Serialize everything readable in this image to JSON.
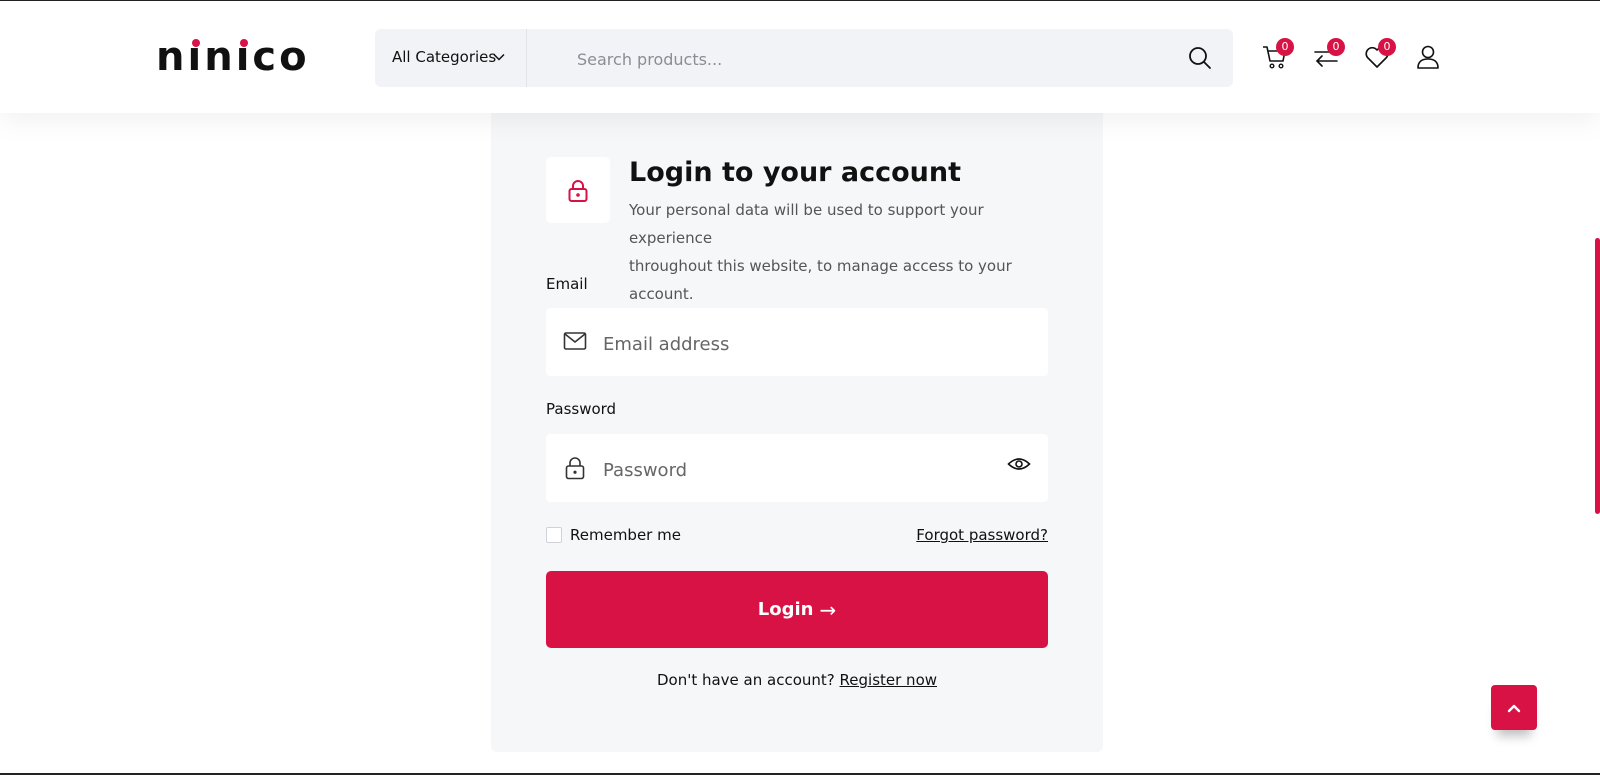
{
  "brand": {
    "logo_text": "ninico",
    "accent_color": "#d81245"
  },
  "header": {
    "category_select": "All Categories",
    "search_placeholder": "Search products...",
    "cart_count": "0",
    "compare_count": "0",
    "wishlist_count": "0",
    "icons": [
      "search-icon",
      "cart-icon",
      "compare-icon",
      "wishlist-icon",
      "user-icon"
    ]
  },
  "login": {
    "title": "Login to your account",
    "description": "Your personal data will be used to support your experience\nthroughout this website, to manage access to your account.",
    "email_label": "Email",
    "email_placeholder": "Email address",
    "password_label": "Password",
    "password_placeholder": "Password",
    "remember_label": "Remember me",
    "remember_checked": false,
    "forgot_label": "Forgot password?",
    "submit_label": "Login",
    "submit_arrow": "→",
    "register_prompt": "Don't have an account?",
    "register_link": "Register now"
  }
}
